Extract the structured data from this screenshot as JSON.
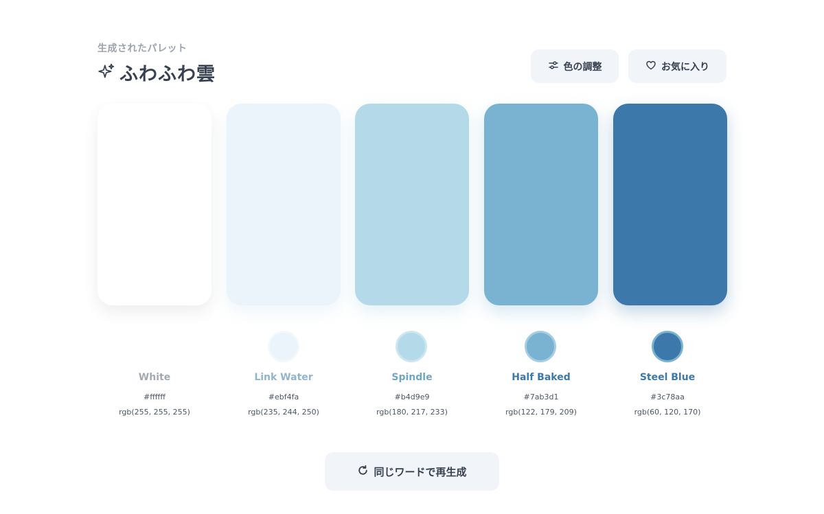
{
  "header": {
    "subtitle": "生成されたパレット",
    "title": "ふわふわ雲",
    "title_icon": "sparkles-icon"
  },
  "actions": {
    "adjust_label": "色の調整",
    "adjust_icon": "sliders-icon",
    "favorite_label": "お気に入り",
    "favorite_icon": "heart-icon",
    "regenerate_label": "同じワードで再生成",
    "regenerate_icon": "refresh-icon"
  },
  "palette": [
    {
      "name": "White",
      "hex": "#ffffff",
      "rgb": "rgb(255, 255, 255)",
      "name_color": "#a3a8b3"
    },
    {
      "name": "Link Water",
      "hex": "#ebf4fa",
      "rgb": "rgb(235, 244, 250)",
      "name_color": "#8fb6cc"
    },
    {
      "name": "Spindle",
      "hex": "#b4d9e9",
      "rgb": "rgb(180, 217, 233)",
      "name_color": "#6fa6c4"
    },
    {
      "name": "Half Baked",
      "hex": "#7ab3d1",
      "rgb": "rgb(122, 179, 209)",
      "name_color": "#3c78aa"
    },
    {
      "name": "Steel Blue",
      "hex": "#3c78aa",
      "rgb": "rgb(60, 120, 170)",
      "name_color": "#3c78aa"
    }
  ]
}
